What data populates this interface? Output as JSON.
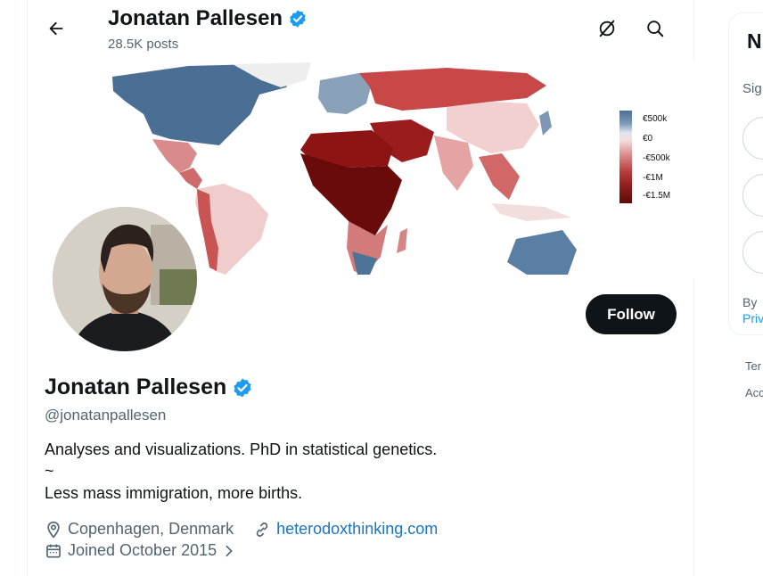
{
  "header": {
    "name": "Jonatan Pallesen",
    "post_count": "28.5K posts"
  },
  "banner": {
    "legend": {
      "labels": [
        "€500k",
        "€0",
        "-€500k",
        "-€1M",
        "-€1.5M"
      ],
      "colors": {
        "high_positive": "#4b6f94",
        "zero": "#dfe6ee",
        "negative": "#b83c3c",
        "most_negative": "#5a0a0a"
      }
    }
  },
  "profile": {
    "name": "Jonatan Pallesen",
    "handle": "@jonatanpallesen",
    "follow_label": "Follow",
    "bio_lines": [
      "Analyses and visualizations. PhD in statistical genetics.",
      "~",
      "Less mass immigration, more births."
    ],
    "location": "Copenhagen, Denmark",
    "website": "heterodoxthinking.com",
    "joined": "Joined October 2015",
    "verified": true
  },
  "sidebar": {
    "title_fragment": "N",
    "sign_fragment": "Sig",
    "by_fragment": "By",
    "privacy_fragment": "Priv",
    "footer_links": [
      "Ter",
      "Acc"
    ]
  },
  "colors": {
    "verified_blue": "#1d9bf0",
    "link_blue": "#1d74c2",
    "text_secondary": "#536471",
    "button_dark": "#0f1419"
  },
  "icons": {
    "back": "arrow-left-icon",
    "grok": "grok-icon",
    "search": "search-icon",
    "verified": "verified-badge-icon",
    "location": "location-pin-icon",
    "link": "link-icon",
    "calendar": "calendar-icon",
    "chevron": "chevron-right-icon"
  }
}
